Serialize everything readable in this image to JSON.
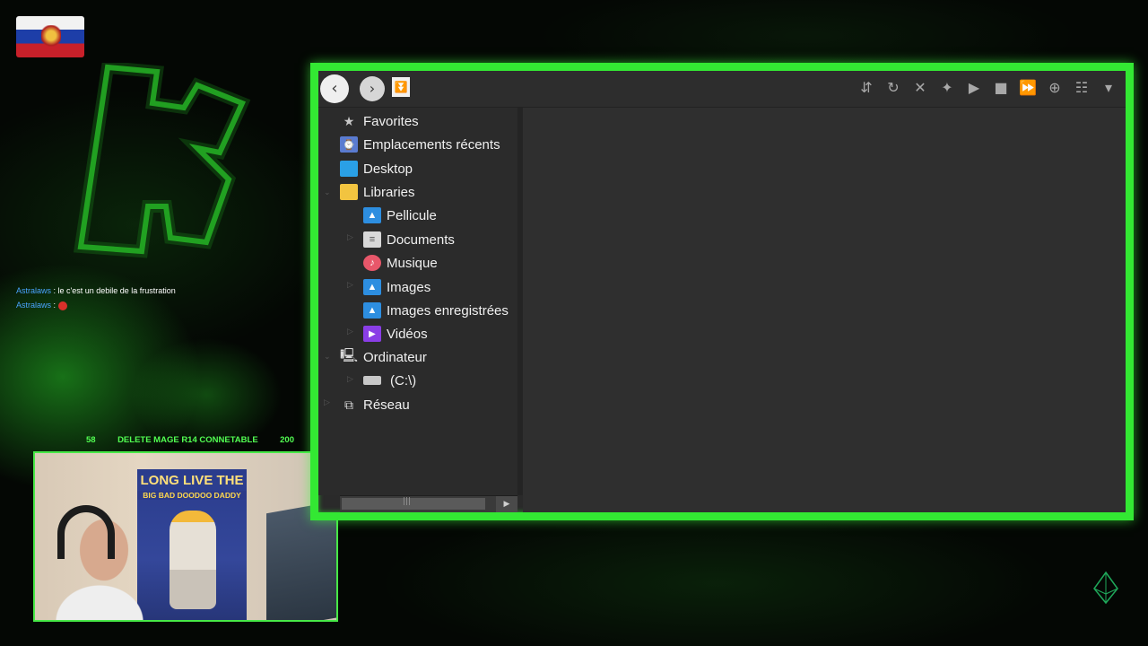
{
  "overlay": {
    "chat": [
      {
        "user": "Astralaws",
        "message": " : le c'est un debile de la frustration"
      },
      {
        "user": "Astralaws",
        "message": " : "
      }
    ],
    "ticker": {
      "left": "58",
      "title": "DELETE MAGE R14 CONNETABLE",
      "right": "200"
    },
    "poster": {
      "title": "LONG LIVE THE",
      "subtitle": "BIG BAD DOODOO DADDY"
    }
  },
  "explorer": {
    "toolbar": {
      "back_icon": "chevron-left",
      "forward_icon": "chevron-right",
      "more_icon": "double-chevron-down",
      "tools": [
        "sync-icon",
        "refresh-icon",
        "close-icon",
        "pin-icon",
        "play-icon",
        "stop-icon",
        "play-next-icon",
        "search-globe-icon",
        "view-icon",
        "dropdown-icon"
      ]
    },
    "tree": [
      {
        "label": "Favorites",
        "icon": "star-icon"
      },
      {
        "label": "Emplacements récents",
        "icon": "recent-icon"
      },
      {
        "label": "Desktop",
        "icon": "desktop-icon"
      },
      {
        "label": "Libraries",
        "icon": "folder-icon"
      },
      {
        "label": "Pellicule",
        "icon": "pictures-icon"
      },
      {
        "label": "Documents",
        "icon": "documents-icon"
      },
      {
        "label": "Musique",
        "icon": "music-icon"
      },
      {
        "label": "Images",
        "icon": "pictures-icon"
      },
      {
        "label": "Images enregistrées",
        "icon": "pictures-icon"
      },
      {
        "label": "Vidéos",
        "icon": "video-icon"
      },
      {
        "label": "Ordinateur",
        "icon": "computer-icon"
      },
      {
        "label": "(C:\\)",
        "icon": "drive-icon"
      },
      {
        "label": "Réseau",
        "icon": "network-icon"
      }
    ]
  }
}
